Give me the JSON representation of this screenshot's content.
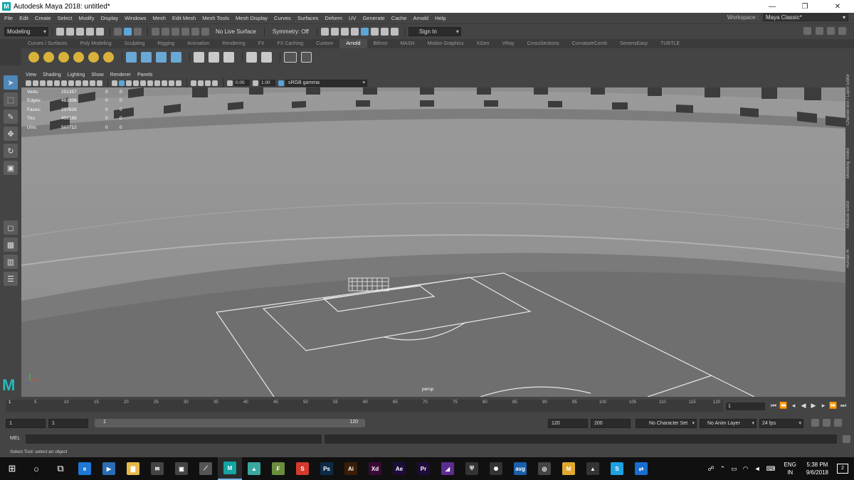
{
  "window": {
    "title": "Autodesk Maya 2018: untitled*",
    "logo": "M",
    "minimize": "—",
    "maximize": "❐",
    "close": "✕"
  },
  "menu": [
    "File",
    "Edit",
    "Create",
    "Select",
    "Modify",
    "Display",
    "Windows",
    "Mesh",
    "Edit Mesh",
    "Mesh Tools",
    "Mesh Display",
    "Curves",
    "Surfaces",
    "Deform",
    "UV",
    "Generate",
    "Cache",
    "Arnold",
    "Help"
  ],
  "workspace": {
    "label": "Workspace :",
    "value": "Maya Classic*"
  },
  "statusline": {
    "mode": "Modeling",
    "live_surface": "No Live Surface",
    "symmetry": "Symmetry: Off",
    "sign_in": "Sign In"
  },
  "shelf_tabs": [
    "Curves / Surfaces",
    "Poly Modeling",
    "Sculpting",
    "Rigging",
    "Animation",
    "Rendering",
    "FX",
    "FX Caching",
    "Custom",
    "Arnold",
    "Bifrost",
    "MASH",
    "Motion Graphics",
    "XGen",
    "VRay",
    "CrossSections",
    "CurvatureComb",
    "SevensEasy",
    "TURTLE"
  ],
  "active_shelf_tab": "Arnold",
  "panel_menu": [
    "View",
    "Shading",
    "Lighting",
    "Show",
    "Renderer",
    "Panels"
  ],
  "panel_toolbar": {
    "val_a": "0.00",
    "val_b": "1.00",
    "color_space": "sRGB gamma"
  },
  "hud": [
    {
      "label": "Verts:",
      "v1": "251357",
      "v2": "0",
      "v3": "0"
    },
    {
      "label": "Edges:",
      "v1": "481306",
      "v2": "0",
      "v3": "0"
    },
    {
      "label": "Faces:",
      "v1": "237826",
      "v2": "0",
      "v3": "0"
    },
    {
      "label": "Tris:",
      "v1": "458188",
      "v2": "0",
      "v3": "0"
    },
    {
      "label": "UVs:",
      "v1": "507712",
      "v2": "0",
      "v3": "0"
    }
  ],
  "camera": "persp",
  "right_panels": [
    "Channel Box / Layer Editor",
    "Modeling Toolkit",
    "Attribute Editor",
    "Human IK"
  ],
  "timeline": {
    "ticks": [
      "5",
      "10",
      "15",
      "20",
      "25",
      "30",
      "35",
      "40",
      "45",
      "50",
      "55",
      "60",
      "65",
      "70",
      "75",
      "80",
      "85",
      "90",
      "95",
      "100",
      "105",
      "110",
      "115",
      "120"
    ],
    "start_marker": "1",
    "current_frame": "1"
  },
  "range": {
    "start": "1",
    "start2": "1",
    "bar_start": "1",
    "bar_end": "120",
    "end": "120",
    "end2": "200",
    "character_set": "No Character Set",
    "anim_layer": "No Anim Layer",
    "fps": "24 fps"
  },
  "command": {
    "lang": "MEL"
  },
  "help_line": "Select Tool: select an object",
  "taskbar": {
    "apps": [
      {
        "name": "edge",
        "glyph": "e",
        "color": "#1e78d6"
      },
      {
        "name": "powershell",
        "glyph": "▶",
        "color": "#2b6cb5"
      },
      {
        "name": "explorer",
        "glyph": "▇",
        "color": "#e8b84a"
      },
      {
        "name": "mail",
        "glyph": "✉",
        "color": "#444"
      },
      {
        "name": "store",
        "glyph": "▣",
        "color": "#444"
      },
      {
        "name": "maya-2017",
        "glyph": "⟋",
        "color": "#555"
      },
      {
        "name": "maya",
        "glyph": "M",
        "color": "#15a3a3"
      },
      {
        "name": "mudbox",
        "glyph": "▲",
        "color": "#3aa7a0"
      },
      {
        "name": "fusion",
        "glyph": "F",
        "color": "#6b8e3d"
      },
      {
        "name": "substance",
        "glyph": "S",
        "color": "#d33a2c"
      },
      {
        "name": "photoshop",
        "glyph": "Ps",
        "color": "#0f2a45"
      },
      {
        "name": "illustrator",
        "glyph": "Ai",
        "color": "#3a1d06"
      },
      {
        "name": "xd",
        "glyph": "Xd",
        "color": "#3a0a35"
      },
      {
        "name": "after-effects",
        "glyph": "Ae",
        "color": "#1d0b3a"
      },
      {
        "name": "premiere",
        "glyph": "Pr",
        "color": "#1d0b3a"
      },
      {
        "name": "vs",
        "glyph": "◢",
        "color": "#5c2d91"
      },
      {
        "name": "shield",
        "glyph": "⛨",
        "color": "#333"
      },
      {
        "name": "aperture",
        "glyph": "✺",
        "color": "#333"
      },
      {
        "name": "avg",
        "glyph": "avg",
        "color": "#1a5fa8"
      },
      {
        "name": "obs",
        "glyph": "◎",
        "color": "#444"
      },
      {
        "name": "mudbox-m",
        "glyph": "M",
        "color": "#e0a92b"
      },
      {
        "name": "photos",
        "glyph": "▲",
        "color": "#333"
      },
      {
        "name": "skype",
        "glyph": "S",
        "color": "#1fa0e0"
      },
      {
        "name": "teamviewer",
        "glyph": "⇄",
        "color": "#1a6dd0"
      }
    ],
    "lang_a": "ENG",
    "lang_b": "IN",
    "time": "5:38 PM",
    "date": "9/6/2018",
    "notifications": "2"
  }
}
